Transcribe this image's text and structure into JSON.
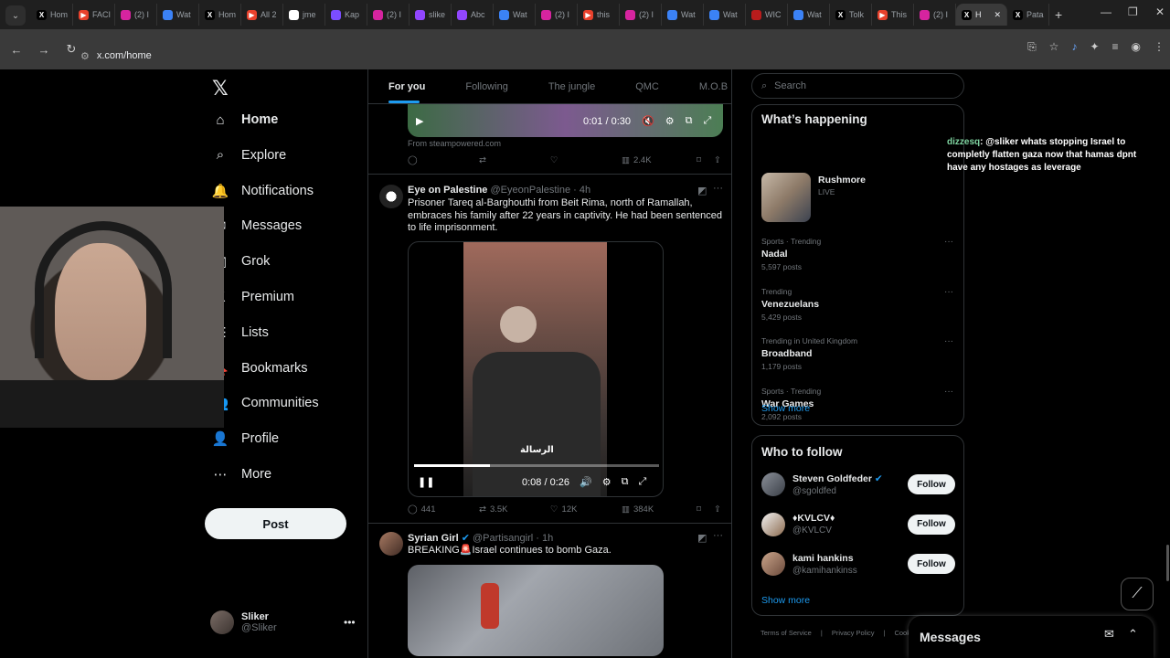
{
  "browser": {
    "tabs": [
      {
        "icon": "x-icon",
        "label": "Hom",
        "color": "#000000"
      },
      {
        "icon": "youtube-icon",
        "label": "FACI",
        "color": "#e8412c"
      },
      {
        "icon": "instagram-icon",
        "label": "(2) I",
        "color": "#d6249f"
      },
      {
        "icon": "watch-icon",
        "label": "Wat",
        "color": "#3b82f6"
      },
      {
        "icon": "x-icon",
        "label": "Hom",
        "color": "#000000"
      },
      {
        "icon": "youtube-icon",
        "label": "All 2",
        "color": "#e8412c"
      },
      {
        "icon": "google-icon",
        "label": "jme",
        "color": "#ffffff"
      },
      {
        "icon": "kapwing-icon",
        "label": "Kap",
        "color": "#7b4dff"
      },
      {
        "icon": "instagram-icon",
        "label": "(2) I",
        "color": "#d6249f"
      },
      {
        "icon": "twitch-icon",
        "label": "slike",
        "color": "#9146ff"
      },
      {
        "icon": "twitch-icon",
        "label": "Abc",
        "color": "#9146ff"
      },
      {
        "icon": "watch-icon",
        "label": "Wat",
        "color": "#3b82f6"
      },
      {
        "icon": "instagram-icon",
        "label": "(2) I",
        "color": "#d6249f"
      },
      {
        "icon": "youtube-icon",
        "label": "this",
        "color": "#e8412c"
      },
      {
        "icon": "instagram-icon",
        "label": "(2) I",
        "color": "#d6249f"
      },
      {
        "icon": "watch-icon",
        "label": "Wat",
        "color": "#3b82f6"
      },
      {
        "icon": "watch-icon",
        "label": "Wat",
        "color": "#3b82f6"
      },
      {
        "icon": "wiki-icon",
        "label": "WIC",
        "color": "#b91c1c"
      },
      {
        "icon": "watch-icon",
        "label": "Wat",
        "color": "#3b82f6"
      },
      {
        "icon": "x-icon",
        "label": "Tolk",
        "color": "#000000"
      },
      {
        "icon": "youtube-icon",
        "label": "This",
        "color": "#e8412c"
      },
      {
        "icon": "instagram-icon",
        "label": "(2) I",
        "color": "#d6249f"
      },
      {
        "icon": "x-icon",
        "label": "H",
        "color": "#000000",
        "active": true
      },
      {
        "icon": "x-icon",
        "label": "Pata",
        "color": "#000000"
      }
    ],
    "url": "x.com/home"
  },
  "nav": {
    "items": [
      {
        "id": "home",
        "icon": "home-icon",
        "glyph": "⌂",
        "label": "Home",
        "active": true
      },
      {
        "id": "explore",
        "icon": "search-icon",
        "glyph": "⌕",
        "label": "Explore"
      },
      {
        "id": "notifications",
        "icon": "bell-icon",
        "glyph": "🔔",
        "label": "Notifications"
      },
      {
        "id": "messages",
        "icon": "mail-icon",
        "glyph": "✉",
        "label": "Messages"
      },
      {
        "id": "grok",
        "icon": "grok-icon",
        "glyph": "◩",
        "label": "Grok"
      },
      {
        "id": "premium",
        "icon": "x-premium-icon",
        "glyph": "𝕏",
        "label": "Premium"
      },
      {
        "id": "lists",
        "icon": "list-icon",
        "glyph": "☰",
        "label": "Lists"
      },
      {
        "id": "bookmarks",
        "icon": "bookmark-icon",
        "glyph": "🔖",
        "label": "Bookmarks"
      },
      {
        "id": "communities",
        "icon": "communities-icon",
        "glyph": "👥",
        "label": "Communities"
      },
      {
        "id": "profile",
        "icon": "person-icon",
        "glyph": "👤",
        "label": "Profile"
      },
      {
        "id": "more",
        "icon": "more-circle-icon",
        "glyph": "⋯",
        "label": "More"
      }
    ],
    "post_label": "Post",
    "user": {
      "name": "Sliker",
      "handle": "@Sliker"
    }
  },
  "feed": {
    "tabs": [
      "For you",
      "Following",
      "The jungle",
      "QMC",
      "M.O.B"
    ],
    "active_tab": "For you",
    "top_video": {
      "time": "0:01 / 0:30",
      "source": "From steampowered.com",
      "views": "2.4K"
    },
    "posts": [
      {
        "name": "Eye on Palestine",
        "handle": "@EyeonPalestine",
        "time": "4h",
        "text": "Prisoner Tareq al-Barghouthi from Beit Rima, north of Ramallah, embraces his family after 22 years in captivity. He had been sentenced to life imprisonment.",
        "video_time": "0:08 / 0:26",
        "video_progress": 0.31,
        "watermark": "الرسالة",
        "replies": "441",
        "reposts": "3.5K",
        "likes": "12K",
        "views": "384K"
      },
      {
        "name": "Syrian Girl",
        "handle": "@Partisangirl",
        "time": "1h",
        "text": "BREAKING🚨Israel continues to bomb Gaza."
      }
    ]
  },
  "sidebar": {
    "search_placeholder": "Search",
    "happening_title": "What’s happening",
    "live": {
      "title": "Rushmore",
      "badge": "LIVE"
    },
    "trends": [
      {
        "meta": "Sports · Trending",
        "title": "Nadal",
        "posts": "5,597 posts"
      },
      {
        "meta": "Trending",
        "title": "Venezuelans",
        "posts": "5,429 posts"
      },
      {
        "meta": "Trending in United Kingdom",
        "title": "Broadband",
        "posts": "1,179 posts"
      },
      {
        "meta": "Sports · Trending",
        "title": "War Games",
        "posts": "2,092 posts"
      }
    ],
    "show_more": "Show more",
    "who_to_follow_title": "Who to follow",
    "follow": [
      {
        "name": "Steven Goldfeder",
        "handle": "@sgoldfed",
        "verified": true
      },
      {
        "name": "♦KVLCV♦",
        "handle": "@KVLCV"
      },
      {
        "name": "kami hankins",
        "handle": "@kamihankinss"
      }
    ],
    "follow_label": "Follow",
    "show_more_2": "Show more",
    "footer": [
      "Terms of Service",
      "|",
      "Privacy Policy",
      "|",
      "Cookie P"
    ]
  },
  "overlay": {
    "chat_user": "dizzesq",
    "chat_text": ": @sliker whats stopping Israel to completly flatten gaza now that hamas dpnt have any hostages as leverage"
  },
  "messages_panel": {
    "title": "Messages"
  }
}
